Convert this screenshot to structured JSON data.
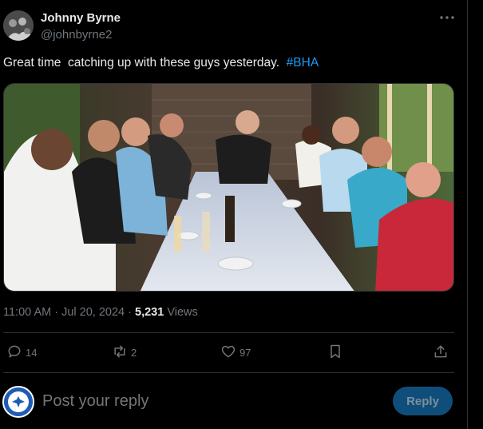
{
  "author": {
    "name": "Johnny Byrne",
    "handle": "@johnbyrne2"
  },
  "tweet": {
    "text_before": "Great time  catching up with these guys yesterday.  ",
    "hashtag": "#BHA",
    "photo_icon": "group-photo"
  },
  "meta": {
    "time": "11:00 AM",
    "separator": " · ",
    "date": "Jul 20, 2024",
    "separator2": " · ",
    "views_count": "5,231",
    "views_label": " Views"
  },
  "actions": {
    "replies": "14",
    "reposts": "2",
    "likes": "97"
  },
  "reply": {
    "placeholder": "Post your reply",
    "button_label": "Reply"
  },
  "colors": {
    "background": "#000000",
    "text": "#e7e9ea",
    "secondary": "#71767b",
    "accent": "#1d9bf0",
    "reply_button": "#0f4e7a"
  },
  "icons": [
    "more-icon",
    "reply-icon",
    "repost-icon",
    "like-icon",
    "bookmark-icon",
    "share-icon"
  ]
}
